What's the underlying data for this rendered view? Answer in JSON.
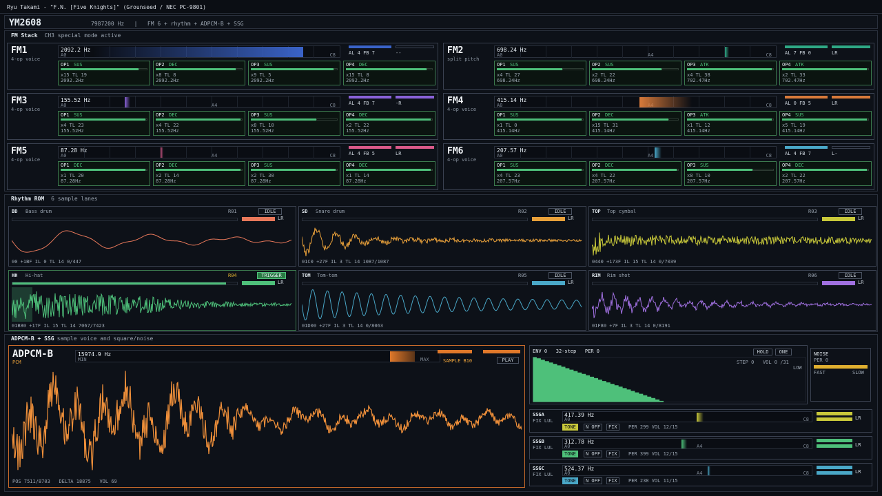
{
  "header": {
    "title": "Ryu Takami - \"F.N. [Five Knights]\" (Grounseed / NEC PC-9801)"
  },
  "chip": {
    "name": "YM2608",
    "clock": "7987200 Hz",
    "sep": "|",
    "mode": "FM 6 + rhythm + ADPCM-B + SSG"
  },
  "fm_section": {
    "label": "FM Stack",
    "note": "CH3 special mode active"
  },
  "fm": [
    {
      "name": "FM1",
      "sub": "4-op voice",
      "freq": "2092.2 Hz",
      "a0": "A0",
      "a4": "",
      "c8": "C8",
      "al": "AL 4 FB 7",
      "pan": "--",
      "color": "#3a63c8",
      "ops": [
        {
          "op": "OP1",
          "state": "SUS",
          "l1": "x15 TL 19",
          "l2": "2092.2Hz",
          "level": 0.9
        },
        {
          "op": "OP2",
          "state": "DEC",
          "l1": "x8 TL 8",
          "l2": "2092.2Hz",
          "level": 0.92
        },
        {
          "op": "OP3",
          "state": "SUS",
          "l1": "x9 TL 5",
          "l2": "2092.2Hz",
          "level": 0.95
        },
        {
          "op": "OP4",
          "state": "DEC",
          "l1": "x15 TL 8",
          "l2": "2092.2Hz",
          "level": 0.93
        }
      ]
    },
    {
      "name": "FM2",
      "sub": "split pitch",
      "freq": "698.24 Hz",
      "a0": "A0",
      "a4": "A4",
      "c8": "C8",
      "al": "AL 7 FB 0",
      "pan": "LR",
      "color": "#2fa885",
      "ops": [
        {
          "op": "OP1",
          "state": "SUS",
          "l1": "x4 TL 27",
          "l2": "698.24Hz",
          "level": 0.75
        },
        {
          "op": "OP2",
          "state": "SUS",
          "l1": "x2 TL 22",
          "l2": "698.24Hz",
          "level": 0.8
        },
        {
          "op": "OP3",
          "state": "ATK",
          "l1": "x4 TL 38",
          "l2": "702.47Hz",
          "level": 0.98
        },
        {
          "op": "OP4",
          "state": "ATK",
          "l1": "x2 TL 33",
          "l2": "702.47Hz",
          "level": 0.98
        }
      ]
    },
    {
      "name": "FM3",
      "sub": "4-op voice",
      "freq": "155.52 Hz",
      "a0": "A0",
      "a4": "A4",
      "c8": "C8",
      "al": "AL 4 FB 7",
      "pan": "-R",
      "color": "#8a62d8",
      "ops": [
        {
          "op": "OP1",
          "state": "SUS",
          "l1": "x4 TL 23",
          "l2": "155.52Hz",
          "level": 0.98
        },
        {
          "op": "OP2",
          "state": "DEC",
          "l1": "x4 TL 22",
          "l2": "155.52Hz",
          "level": 0.98
        },
        {
          "op": "OP3",
          "state": "SUS",
          "l1": "x8 TL 10",
          "l2": "155.52Hz",
          "level": 0.75
        },
        {
          "op": "OP4",
          "state": "DEC",
          "l1": "x2 TL 22",
          "l2": "155.52Hz",
          "level": 0.98
        }
      ]
    },
    {
      "name": "FM4",
      "sub": "4-op voice",
      "freq": "415.14 Hz",
      "a0": "A0",
      "a4": "A4",
      "c8": "C8",
      "al": "AL 0 FB 5",
      "pan": "LR",
      "color": "#d87a3a",
      "ops": [
        {
          "op": "OP1",
          "state": "SUS",
          "l1": "x1 TL 0",
          "l2": "415.14Hz",
          "level": 0.98
        },
        {
          "op": "OP2",
          "state": "DEC",
          "l1": "x15 TL 31",
          "l2": "415.14Hz",
          "level": 0.88
        },
        {
          "op": "OP3",
          "state": "ATK",
          "l1": "x1 TL 12",
          "l2": "415.14Hz",
          "level": 0.98
        },
        {
          "op": "OP4",
          "state": "SUS",
          "l1": "x5 TL 19",
          "l2": "415.14Hz",
          "level": 0.98
        }
      ]
    },
    {
      "name": "FM5",
      "sub": "4-op voice",
      "freq": "87.28 Hz",
      "a0": "A0",
      "a4": "A4",
      "c8": "C8",
      "al": "AL 4 FB 5",
      "pan": "LR",
      "color": "#d85a8a",
      "ops": [
        {
          "op": "OP1",
          "state": "DEC",
          "l1": "x1 TL 20",
          "l2": "87.28Hz",
          "level": 0.98
        },
        {
          "op": "OP2",
          "state": "DEC",
          "l1": "x2 TL 14",
          "l2": "87.28Hz",
          "level": 0.98
        },
        {
          "op": "OP3",
          "state": "SUS",
          "l1": "x2 TL 30",
          "l2": "87.28Hz",
          "level": 0.98
        },
        {
          "op": "OP4",
          "state": "DEC",
          "l1": "x1 TL 14",
          "l2": "87.28Hz",
          "level": 0.98
        }
      ]
    },
    {
      "name": "FM6",
      "sub": "4-op voice",
      "freq": "207.57 Hz",
      "a0": "A0",
      "a4": "A4",
      "c8": "C8",
      "al": "AL 4 FB 7",
      "pan": "L-",
      "color": "#4aa8c8",
      "ops": [
        {
          "op": "OP1",
          "state": "SUS",
          "l1": "x4 TL 23",
          "l2": "207.57Hz",
          "level": 0.98
        },
        {
          "op": "OP2",
          "state": "DEC",
          "l1": "x4 TL 22",
          "l2": "207.57Hz",
          "level": 0.98
        },
        {
          "op": "OP3",
          "state": "SUS",
          "l1": "x8 TL 10",
          "l2": "207.57Hz",
          "level": 0.75
        },
        {
          "op": "OP4",
          "state": "DEC",
          "l1": "x2 TL 22",
          "l2": "207.57Hz",
          "level": 0.98
        }
      ]
    }
  ],
  "rhythm_section": {
    "label": "Rhythm ROM",
    "note": "6 sample lanes"
  },
  "rhythm": [
    {
      "code": "BD",
      "name": "Bass drum",
      "rom": "R01",
      "state": "IDLE",
      "pan": "LR",
      "foot": "00 +1BF  IL 0  TL 14  0/447",
      "color": "#e8785a"
    },
    {
      "code": "SD",
      "name": "Snare drum",
      "rom": "R02",
      "state": "IDLE",
      "pan": "LR",
      "foot": "01C0 +27F  IL 3  TL 14  1087/1087",
      "color": "#e8a03a"
    },
    {
      "code": "TOP",
      "name": "Top cymbal",
      "rom": "R03",
      "state": "IDLE",
      "pan": "LR",
      "foot": "0440 +173F  IL 15  TL 14  0/7039",
      "color": "#c8c83a"
    },
    {
      "code": "HH",
      "name": "Hi-hat",
      "rom": "R04",
      "state": "TRIGGER",
      "pan": "LR",
      "foot": "01B80 +17F  IL 15  TL 14  7067/7423",
      "color": "#4ec07a"
    },
    {
      "code": "TOM",
      "name": "Tom-tom",
      "rom": "R05",
      "state": "IDLE",
      "pan": "LR",
      "foot": "01D00 +27F  IL 3  TL 14  0/8063",
      "color": "#4aa8c8"
    },
    {
      "code": "RIM",
      "name": "Rim shot",
      "rom": "R06",
      "state": "IDLE",
      "pan": "LR",
      "foot": "01F80 +7F  IL 3  TL 14  0/8191",
      "color": "#a070e0"
    }
  ],
  "adpcm_section": {
    "label": "ADPCM-B + SSG",
    "note": "sample voice and square/noise"
  },
  "adpcm": {
    "name": "ADPCM-B",
    "sub": "PCM",
    "freq": "15974.9 Hz",
    "min": "MIN",
    "max": "MAX",
    "sample": "SAMPLE B10",
    "play": "PLAY",
    "pos": "POS 7511/8703",
    "delta": "DELTA 18875",
    "vol": "VOL 69"
  },
  "env": {
    "label": "ENV 0",
    "steps": "32-step",
    "per": "PER 0",
    "hold": "HOLD",
    "one": "ONE",
    "step": "STEP  0",
    "vol": "VOL 0 /31",
    "low": "LOW"
  },
  "noise": {
    "label": "NOISE",
    "per": "PER 0",
    "fast": "FAST",
    "slow": "SLOW"
  },
  "ssg": [
    {
      "name": "SSGA",
      "fix": "FIX LUL",
      "freq": "417.39 Hz",
      "a0": "A0",
      "a4": "",
      "c8": "C8",
      "tone": "TONE",
      "noff": "N OFF",
      "fixb": "FIX",
      "per": "PER 299   VOL 12/15",
      "pan": "LR",
      "color": "#c8c83a"
    },
    {
      "name": "SSGB",
      "fix": "FIX LUL",
      "freq": "312.78 Hz",
      "a0": "A0",
      "a4": "A4",
      "c8": "C8",
      "tone": "TONE",
      "noff": "N OFF",
      "fixb": "FIX",
      "per": "PER 399   VOL 12/15",
      "pan": "LR",
      "color": "#4ec07a"
    },
    {
      "name": "SSGC",
      "fix": "FIX LUL",
      "freq": "524.37 Hz",
      "a0": "A0",
      "a4": "A4",
      "c8": "C8",
      "tone": "TONE",
      "noff": "N OFF",
      "fixb": "FIX",
      "per": "PER 238   VOL 11/15",
      "pan": "LR",
      "color": "#4aa8c8"
    }
  ]
}
